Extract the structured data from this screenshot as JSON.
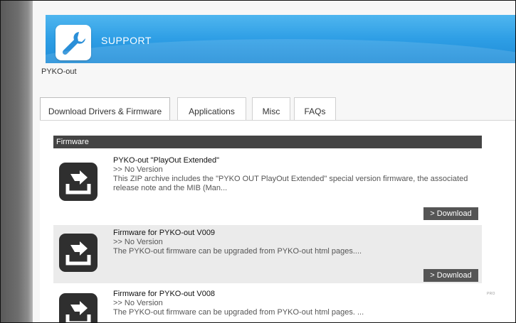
{
  "header": {
    "title": "SUPPORT",
    "icon": "wrench-icon"
  },
  "breadcrumb": "PYKO-out",
  "tabs": [
    {
      "label": "Download Drivers & Firmware",
      "active": true
    },
    {
      "label": "Applications",
      "active": false
    },
    {
      "label": "Misc",
      "active": false
    },
    {
      "label": "FAQs",
      "active": false
    }
  ],
  "section": {
    "title": "Firmware"
  },
  "items": [
    {
      "title": "PYKO-out \"PlayOut Extended\"",
      "version": ">> No Version",
      "description": "This ZIP archive includes the \"PYKO OUT PlayOut Extended\" special version firmware, the associated release note and the MIB (Man...",
      "button": "> Download"
    },
    {
      "title": "Firmware for PYKO-out V009",
      "version": ">> No Version",
      "description": "The PYKO-out firmware can be upgraded from PYKO-out html pages....",
      "button": "> Download"
    },
    {
      "title": "Firmware for PYKO-out V008",
      "version": ">> No Version",
      "description": "The PYKO-out firmware can be upgraded from PYKO-out html pages. ..."
    }
  ],
  "side_text": "PRO",
  "colors": {
    "banner": "#2e9ee5",
    "section_header": "#444444",
    "button": "#555555",
    "icon_tile": "#2f2f2f"
  }
}
